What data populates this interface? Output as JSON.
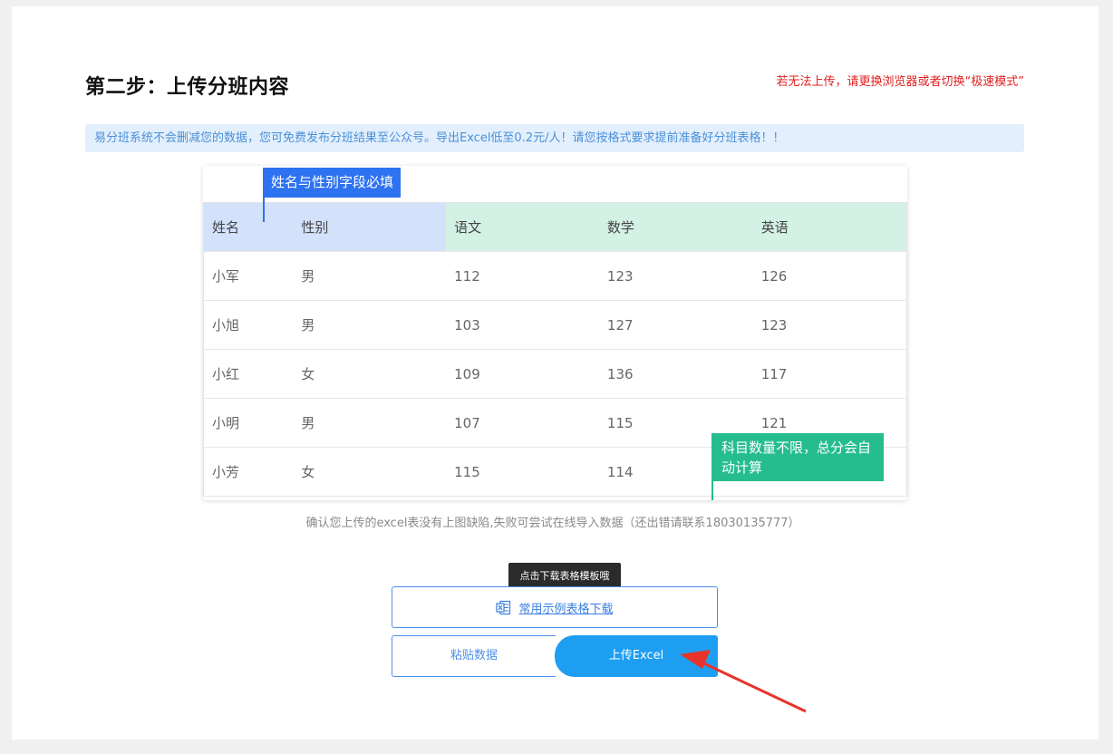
{
  "step": {
    "title": "第二步：上传分班内容",
    "browser_tip": "若无法上传，请更换浏览器或者切换“极速模式”",
    "info": "易分班系统不会删减您的数据，您可免费发布分班结果至公众号。导出Excel低至0.2元/人！请您按格式要求提前准备好分班表格！！"
  },
  "sample": {
    "required_callout": "姓名与性别字段必填",
    "subject_callout": "科目数量不限，总分会自动计算",
    "headers": [
      "姓名",
      "性别",
      "语文",
      "数学",
      "英语"
    ],
    "rows": [
      [
        "小军",
        "男",
        "112",
        "123",
        "126"
      ],
      [
        "小旭",
        "男",
        "103",
        "127",
        "123"
      ],
      [
        "小红",
        "女",
        "109",
        "136",
        "117"
      ],
      [
        "小明",
        "男",
        "107",
        "115",
        "121"
      ],
      [
        "小芳",
        "女",
        "115",
        "114",
        ""
      ]
    ]
  },
  "confirm_note": "确认您上传的excel表没有上图缺陷,失败可尝试在线导入数据（还出错请联系18030135777）",
  "actions": {
    "tooltip": "点击下载表格模板哦",
    "download_label": "常用示例表格下载",
    "paste_label": "粘贴数据",
    "upload_label": "上传Excel"
  },
  "colors": {
    "required_header": "#d3e1fb",
    "optional_header": "#d4f1e5",
    "blue_callout": "#2d72f0",
    "green_callout": "#25bd8e",
    "upload_button": "#1e9ef1",
    "warning_text": "#e02020",
    "annotation_arrow": "#e8332a"
  },
  "icons": {
    "download": "excel-icon"
  }
}
